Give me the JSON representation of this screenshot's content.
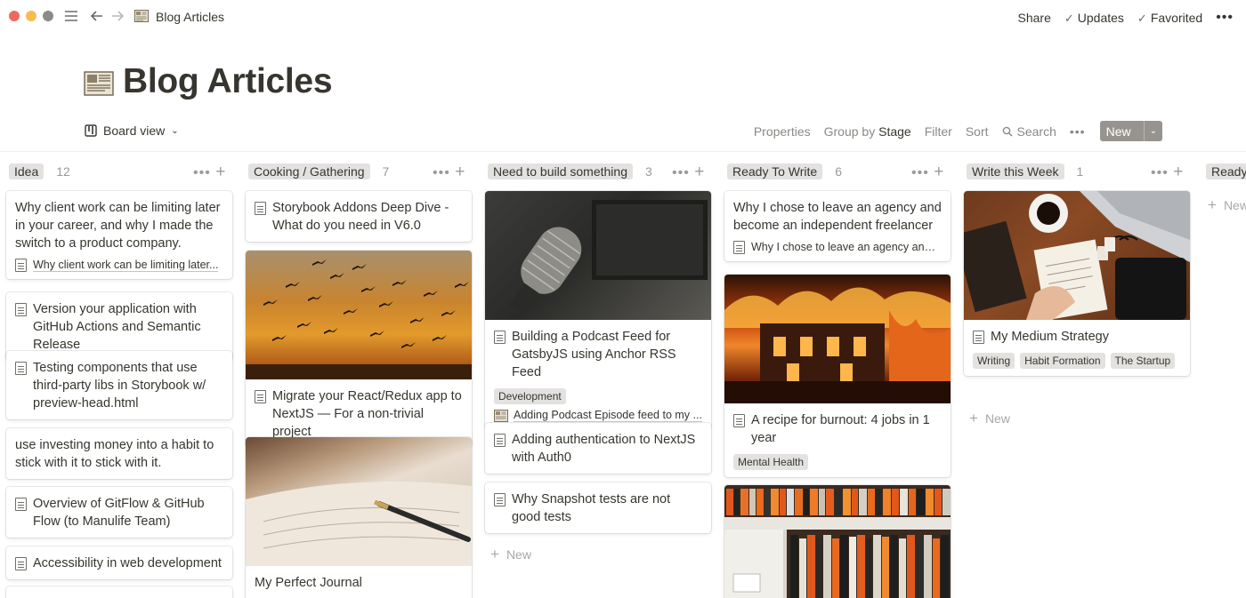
{
  "window": {
    "breadcrumb": "Blog Articles",
    "share": "Share",
    "updates": "Updates",
    "favorited": "Favorited"
  },
  "page": {
    "title": "Blog Articles"
  },
  "toolbar": {
    "view_label": "Board view",
    "properties": "Properties",
    "group_by_prefix": "Group by",
    "group_by_value": "Stage",
    "filter": "Filter",
    "sort": "Sort",
    "search": "Search",
    "new_label": "New"
  },
  "columns": [
    {
      "name": "Idea",
      "count": "12",
      "cards": [
        {
          "title": "Why client work can be limiting later in your career, and why I made the switch to a product company.",
          "sub": "Why client work can be limiting later..."
        },
        {
          "title": "Version your application with GitHub Actions and Semantic Release"
        },
        {
          "title": "Testing components that use third-party libs in Storybook w/ preview-head.html"
        },
        {
          "title": "use investing money into a habit to stick with it to stick with it."
        },
        {
          "title": "Overview of GitFlow & GitHub Flow (to Manulife Team)"
        },
        {
          "title": "Accessibility in web development"
        }
      ]
    },
    {
      "name": "Cooking / Gathering",
      "count": "7",
      "cards": [
        {
          "title": "Storybook Addons Deep Dive - What do you need in V6.0"
        },
        {
          "title": "Migrate your React/Redux app to NextJS — For a non-trivial project"
        },
        {
          "title": "My Perfect Journal"
        }
      ]
    },
    {
      "name": "Need to build something",
      "count": "3",
      "cards": [
        {
          "title": "Building a Podcast Feed for GatsbyJS using Anchor RSS Feed",
          "tags": [
            "Development"
          ],
          "sub": "Adding Podcast Episode feed to my ..."
        },
        {
          "title": "Adding authentication to NextJS with Auth0"
        },
        {
          "title": "Why Snapshot tests are not good tests"
        }
      ],
      "new_label": "New"
    },
    {
      "name": "Ready To Write",
      "count": "6",
      "cards": [
        {
          "title": "Why I chose to leave an agency and become an independent freelancer",
          "sub": "Why I chose to leave an agency and ..."
        },
        {
          "title": "A recipe for burnout: 4 jobs in 1 year",
          "tags": [
            "Mental Health"
          ]
        }
      ]
    },
    {
      "name": "Write this Week",
      "count": "1",
      "cards": [
        {
          "title": "My Medium Strategy",
          "tags": [
            "Writing",
            "Habit Formation",
            "The Startup"
          ]
        }
      ],
      "new_label": "New"
    },
    {
      "name": "Ready",
      "count": "",
      "new_label": "New"
    }
  ],
  "colors": {
    "traffic_red": "#ee6a5f",
    "traffic_yellow": "#f5bd4f",
    "traffic_gray": "#8c8a87",
    "tag_gray": "#e3e2e0",
    "new_button": "#979490"
  }
}
